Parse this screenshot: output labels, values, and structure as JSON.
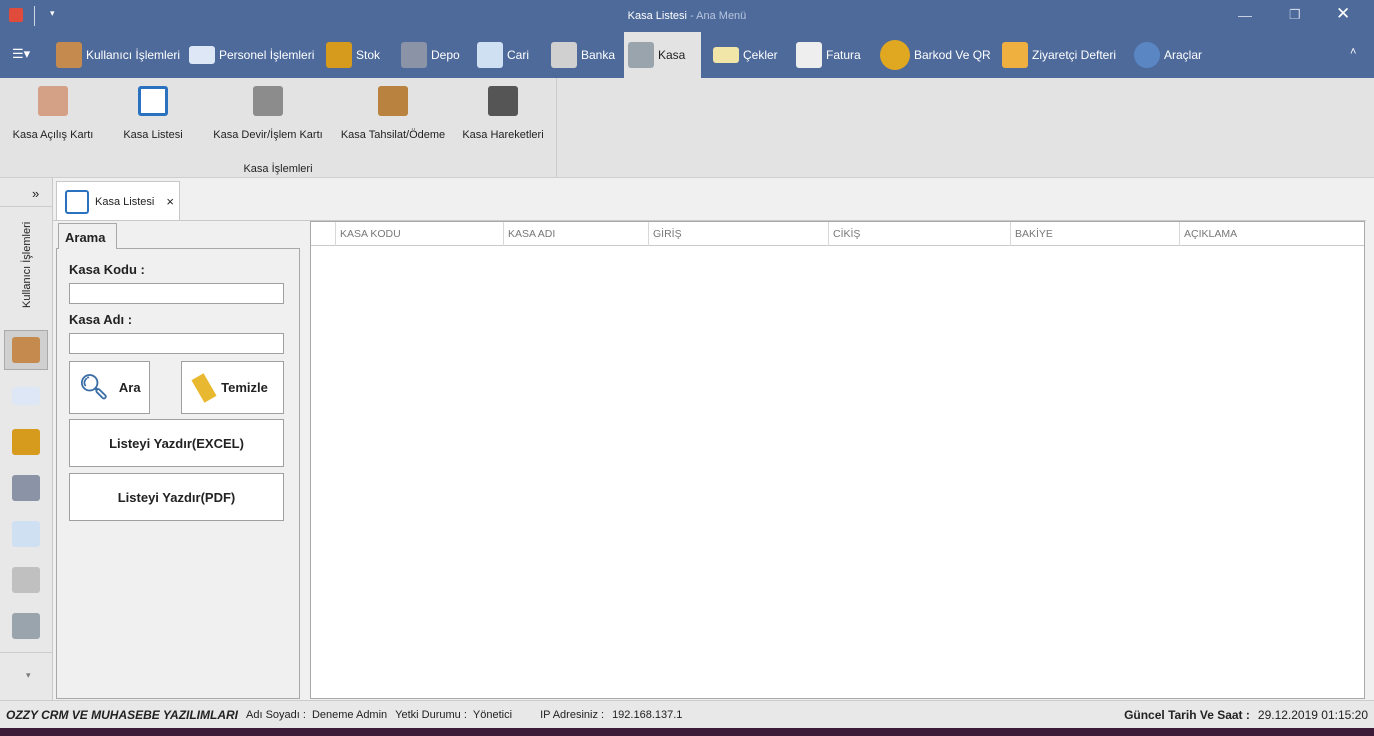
{
  "title": {
    "main": "Kasa Listesi",
    "sub": " - Ana Menü"
  },
  "ribbon_tabs": [
    {
      "label": "Kullanıcı İşlemleri",
      "icon": "user-info-icon"
    },
    {
      "label": "Personel İşlemleri",
      "icon": "id-card-icon"
    },
    {
      "label": "Stok",
      "icon": "crate-icon"
    },
    {
      "label": "Depo",
      "icon": "house-icon"
    },
    {
      "label": "Cari",
      "icon": "badge-icon"
    },
    {
      "label": "Banka",
      "icon": "bank-icon"
    },
    {
      "label": "Kasa",
      "icon": "safe-icon"
    },
    {
      "label": "Çekler",
      "icon": "check-icon"
    },
    {
      "label": "Fatura",
      "icon": "invoice-icon"
    },
    {
      "label": "Barkod Ve QR",
      "icon": "barcode-icon"
    },
    {
      "label": "Ziyaretçi Defteri",
      "icon": "guestbook-icon"
    },
    {
      "label": "Araçlar",
      "icon": "gears-icon"
    }
  ],
  "ribbon_buttons": [
    "Kasa Açılış Kartı",
    "Kasa Listesi",
    "Kasa Devir/İşlem Kartı",
    "Kasa Tahsilat/Ödeme",
    "Kasa Hareketleri"
  ],
  "ribbon_group": "Kasa İşlemleri",
  "nav": {
    "expand": "»",
    "group": "Kullanıcı İşlemleri",
    "more": "▾"
  },
  "doc_tab": {
    "label": "Kasa Listesi",
    "close": "×"
  },
  "search": {
    "tab": "Arama",
    "kasa_kodu_label": "Kasa Kodu :",
    "kasa_kodu_value": "",
    "kasa_adi_label": "Kasa Adı :",
    "kasa_adi_value": "",
    "ara": "Ara",
    "temizle": "Temizle",
    "excel": "Listeyi Yazdır(EXCEL)",
    "pdf": "Listeyi Yazdır(PDF)"
  },
  "grid": {
    "columns": [
      "KASA KODU",
      "KASA ADI",
      "GİRİŞ",
      "CİKİŞ",
      "BAKİYE",
      "AÇIKLAMA"
    ]
  },
  "status": {
    "brand": "OZZY CRM VE MUHASEBE YAZILIMLARI",
    "name_label": "Adı Soyadı :",
    "name": "Deneme Admin",
    "role_label": "Yetki Durumu :",
    "role": "Yönetici",
    "ip_label": "IP Adresiniz :",
    "ip": "192.168.137.1",
    "dt_label": "Güncel Tarih Ve Saat :",
    "dt": "29.12.2019 01:15:20"
  }
}
